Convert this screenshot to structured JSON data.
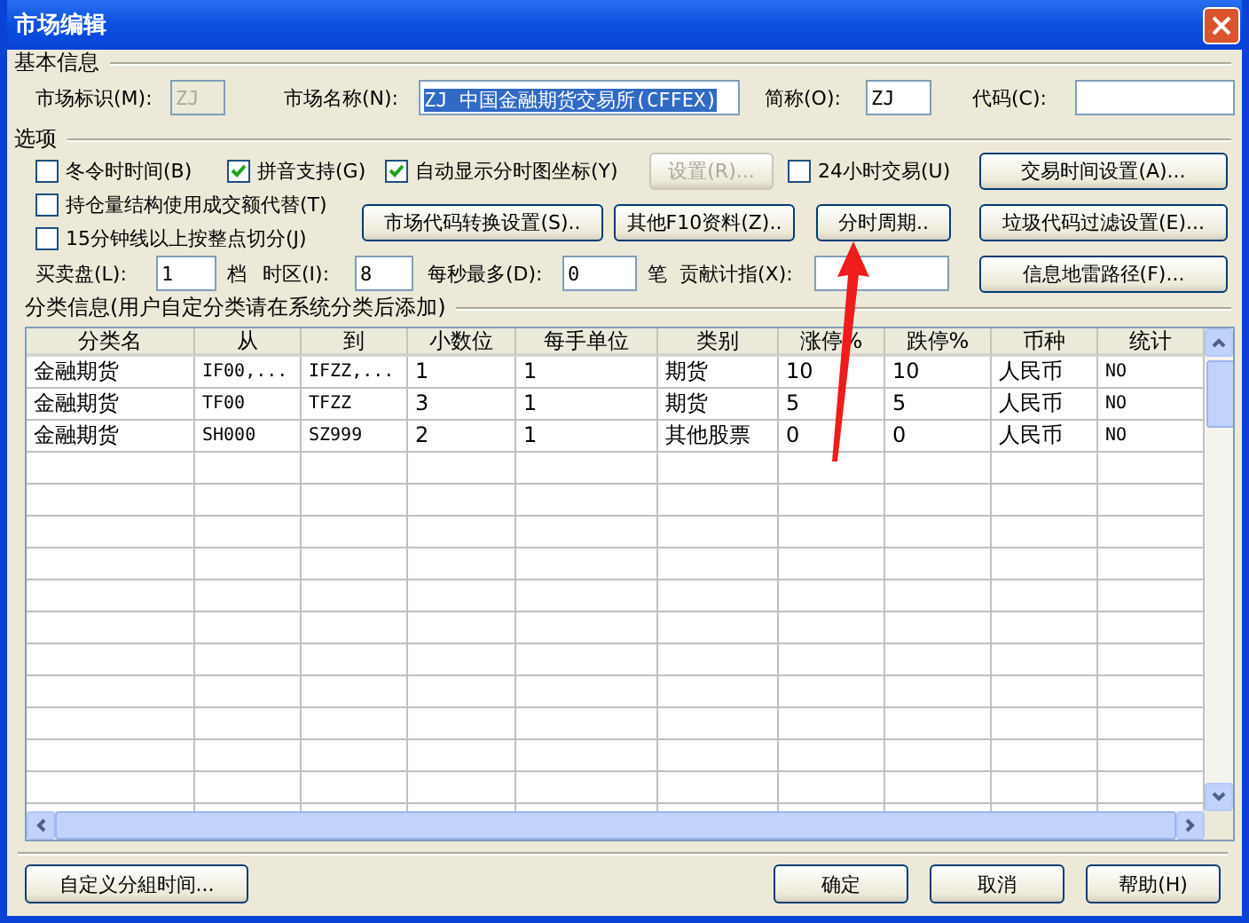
{
  "window": {
    "title": "市场编辑"
  },
  "basic_info": {
    "legend": "基本信息",
    "fields": [
      {
        "label": "市场标识(M):",
        "value": "ZJ",
        "disabled": true,
        "highlighted": false
      },
      {
        "label": "市场名称(N):",
        "value": "ZJ 中国金融期货交易所(CFFEX)",
        "disabled": false,
        "highlighted": true
      },
      {
        "label": "简称(O):",
        "value": "ZJ",
        "disabled": false,
        "highlighted": false
      },
      {
        "label": "代码(C):",
        "disabled": false
      }
    ]
  },
  "options": {
    "legend": "选项",
    "checkboxes": [
      {
        "label": "冬令时时间(B)",
        "checked": false
      },
      {
        "label": "拼音支持(G)",
        "checked": true
      },
      {
        "label": "自动显示分时图坐标(Y)",
        "checked": true
      },
      {
        "label": "24小时交易(U)",
        "checked": false
      },
      {
        "label": "持仓量结构使用成交额代替(T)",
        "checked": false
      },
      {
        "label": "15分钟线以上按整点切分(J)",
        "checked": false
      }
    ],
    "buttons": [
      {
        "label": "设置(R)...",
        "disabled": true
      },
      {
        "label": "交易时间设置(A)...",
        "disabled": false
      },
      {
        "label": "市场代码转换设置(S)..",
        "disabled": false
      },
      {
        "label": "其他F10资料(Z)..",
        "disabled": false
      },
      {
        "label": "分时周期..",
        "disabled": false
      },
      {
        "label": "垃圾代码过滤设置(E)...",
        "disabled": false
      },
      {
        "label": "信息地雷路径(F)...",
        "disabled": false
      }
    ],
    "inputs": [
      {
        "label": "买卖盘(L):",
        "value": "1",
        "unit": "档"
      },
      {
        "label": "时区(I):",
        "value": "8"
      },
      {
        "label": "每秒最多(D):",
        "value": "0",
        "unit": "笔"
      },
      {
        "label": "贡献计指(X):"
      }
    ]
  },
  "category": {
    "legend": "分类信息(用户自定分类请在系统分类后添加)",
    "columns": [
      "分类名",
      "从",
      "到",
      "小数位",
      "每手单位",
      "类别",
      "涨停%",
      "跌停%",
      "币种",
      "统计"
    ],
    "rows": [
      [
        "金融期货",
        "IF00,...",
        "IFZZ,...",
        "1",
        "1",
        "期货",
        "10",
        "10",
        "人民币",
        "NO"
      ],
      [
        "金融期货",
        "TF00",
        "TFZZ",
        "3",
        "1",
        "期货",
        "5",
        "5",
        "人民币",
        "NO"
      ],
      [
        "金融期货",
        "SH000",
        "SZ999",
        "2",
        "1",
        "其他股票",
        "0",
        "0",
        "人民币",
        "NO"
      ]
    ]
  },
  "footer": {
    "left_button": "自定义分組时间...",
    "buttons": [
      "确定",
      "取消",
      "帮助(H)"
    ]
  }
}
